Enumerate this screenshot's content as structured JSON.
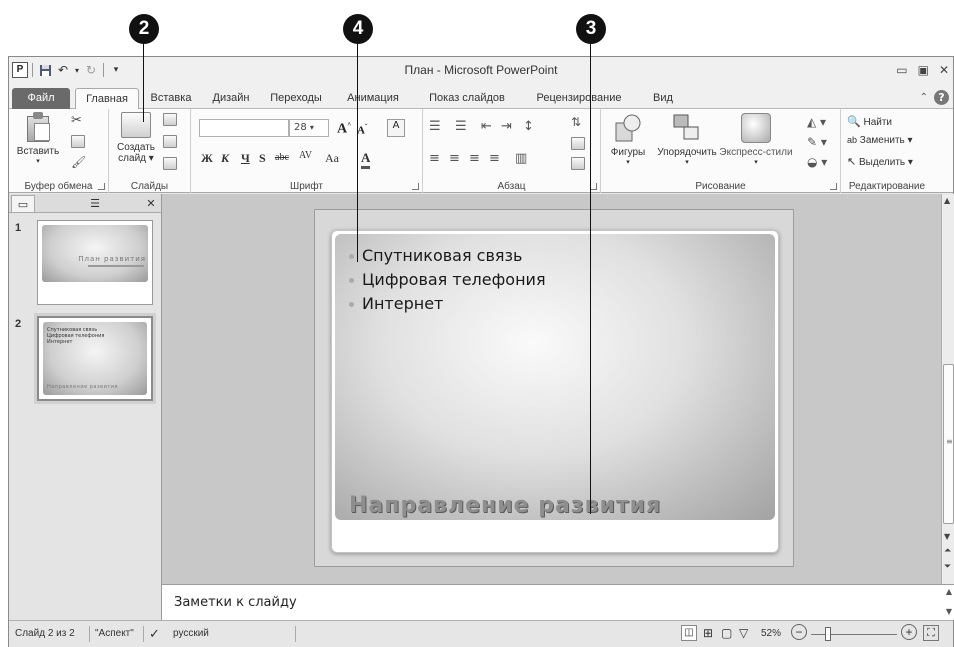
{
  "callouts": [
    "2",
    "4",
    "3"
  ],
  "titlebar": {
    "title": "План - Microsoft PowerPoint",
    "app_icon": "P",
    "qat_icons": [
      "save-icon",
      "undo-icon",
      "redo-icon",
      "customize-qat-icon"
    ]
  },
  "tabs": [
    "Файл",
    "Главная",
    "Вставка",
    "Дизайн",
    "Переходы",
    "Анимация",
    "Показ слайдов",
    "Рецензирование",
    "Вид"
  ],
  "ribbon": {
    "clipboard": {
      "paste": "Вставить",
      "label": "Буфер обмена"
    },
    "slides": {
      "new_slide_line1": "Создать",
      "new_slide_line2": "слайд",
      "label": "Слайды"
    },
    "font": {
      "size": "28",
      "label": "Шрифт",
      "bold": "Ж",
      "italic": "К",
      "underline": "Ч",
      "strike": "S",
      "abc": "abc",
      "spacing": "AV",
      "case": "Aa"
    },
    "paragraph": {
      "label": "Абзац"
    },
    "drawing": {
      "shapes": "Фигуры",
      "arrange": "Упорядочить",
      "quick_styles": "Экспресс-стили",
      "label": "Рисование"
    },
    "editing": {
      "find": "Найти",
      "replace": "Заменить",
      "select": "Выделить",
      "label": "Редактирование"
    }
  },
  "thumbnails": [
    {
      "num": "1",
      "title": "План развития"
    },
    {
      "num": "2",
      "lines": [
        "Спутниковая связь",
        "Цифровая телефония",
        "Интернет"
      ],
      "footer": "Направление развития"
    }
  ],
  "slide": {
    "bullets": [
      "Спутниковая  связь",
      "Цифровая телефония",
      "Интернет"
    ],
    "title": "Направление развития"
  },
  "notes": {
    "placeholder": "Заметки к слайду"
  },
  "status": {
    "slide": "Слайд 2 из 2",
    "theme": "\"Аспект\"",
    "language": "русский",
    "zoom": "52%"
  }
}
